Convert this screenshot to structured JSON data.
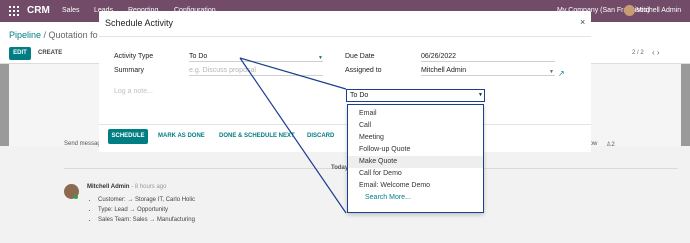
{
  "topbar": {
    "brand": "CRM",
    "menu": [
      "Sales",
      "Leads",
      "Reporting",
      "Configuration"
    ],
    "company": "My Company (San Francisco)",
    "user": "Mitchell Admin"
  },
  "control": {
    "breadcrumb_parent": "Pipeline",
    "breadcrumb_sep": " / ",
    "breadcrumb_current": "Quotation fo",
    "edit_label": "EDIT",
    "create_label": "CREATE",
    "pager": "2 / 2",
    "pager_arrows": "‹ ›"
  },
  "chatter": {
    "send_message": "Send message",
    "follow": "Follow",
    "followers": "2",
    "today": "Today",
    "author": "Mitchell Admin",
    "time": " - 8 hours ago",
    "changes": [
      "Customer: → Storage IT, Carlo Holic",
      "Type: Lead → Opportunity",
      "Sales Team: Sales → Manufacturing"
    ]
  },
  "modal": {
    "title": "Schedule Activity",
    "close": "×",
    "activity_type_label": "Activity Type",
    "activity_type_value": "To Do",
    "summary_label": "Summary",
    "summary_placeholder": "e.g. Discuss proposal",
    "due_date_label": "Due Date",
    "due_date_value": "06/26/2022",
    "assigned_to_label": "Assigned to",
    "assigned_to_value": "Mitchell Admin",
    "note_placeholder": "Log a note...",
    "buttons": {
      "schedule": "SCHEDULE",
      "mark_done": "MARK AS DONE",
      "done_next": "DONE & SCHEDULE NEXT",
      "discard": "DISCARD"
    }
  },
  "dropdown": {
    "value": "To Do",
    "items": [
      "Email",
      "Call",
      "Meeting",
      "Follow-up Quote",
      "Make Quote",
      "Call for Demo",
      "Email: Welcome Demo"
    ],
    "highlighted": "Make Quote",
    "search_more": "Search More..."
  },
  "colors": {
    "brand": "#714b67",
    "accent": "#017e84",
    "callout": "#1a3f8f"
  }
}
